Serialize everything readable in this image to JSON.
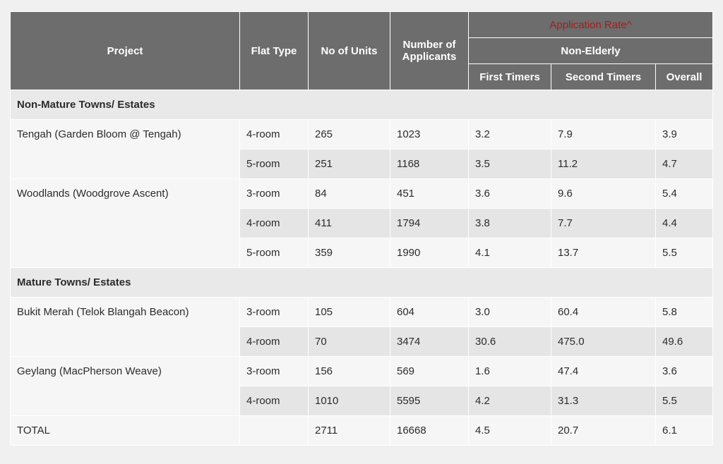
{
  "header": {
    "project": "Project",
    "flat_type": "Flat Type",
    "no_of_units": "No of Units",
    "number_of_applicants_line1": "Number of",
    "number_of_applicants_line2": "Applicants",
    "application_rate": "Application Rate^",
    "non_elderly": "Non-Elderly",
    "first_timers": "First Timers",
    "second_timers": "Second Timers",
    "overall": "Overall"
  },
  "sections": [
    {
      "title": "Non-Mature Towns/ Estates",
      "projects": [
        {
          "name": "Tengah (Garden Bloom @ Tengah)",
          "rows": [
            {
              "flat_type": "4-room",
              "units": "265",
              "applicants": "1023",
              "first": "3.2",
              "second": "7.9",
              "overall": "3.9"
            },
            {
              "flat_type": "5-room",
              "units": "251",
              "applicants": "1168",
              "first": "3.5",
              "second": "11.2",
              "overall": "4.7"
            }
          ]
        },
        {
          "name": "Woodlands (Woodgrove Ascent)",
          "rows": [
            {
              "flat_type": "3-room",
              "units": "84",
              "applicants": "451",
              "first": "3.6",
              "second": "9.6",
              "overall": "5.4"
            },
            {
              "flat_type": "4-room",
              "units": "411",
              "applicants": "1794",
              "first": "3.8",
              "second": "7.7",
              "overall": "4.4"
            },
            {
              "flat_type": "5-room",
              "units": "359",
              "applicants": "1990",
              "first": "4.1",
              "second": "13.7",
              "overall": "5.5"
            }
          ]
        }
      ]
    },
    {
      "title": "Mature Towns/ Estates",
      "projects": [
        {
          "name": "Bukit Merah (Telok Blangah Beacon)",
          "rows": [
            {
              "flat_type": "3-room",
              "units": "105",
              "applicants": "604",
              "first": "3.0",
              "second": "60.4",
              "overall": "5.8"
            },
            {
              "flat_type": "4-room",
              "units": "70",
              "applicants": "3474",
              "first": "30.6",
              "second": "475.0",
              "overall": "49.6"
            }
          ]
        },
        {
          "name": "Geylang (MacPherson Weave)",
          "rows": [
            {
              "flat_type": "3-room",
              "units": "156",
              "applicants": "569",
              "first": "1.6",
              "second": "47.4",
              "overall": "3.6"
            },
            {
              "flat_type": "4-room",
              "units": "1010",
              "applicants": "5595",
              "first": "4.2",
              "second": "31.3",
              "overall": "5.5"
            }
          ]
        }
      ]
    }
  ],
  "total": {
    "label": "TOTAL",
    "units": "2711",
    "applicants": "16668",
    "first": "4.5",
    "second": "20.7",
    "overall": "6.1"
  },
  "colors": {
    "header_bg": "#6d6d6d",
    "header_text": "#ffffff",
    "rate_title": "#a91b1b",
    "row_light": "#f6f6f6",
    "row_dark": "#e5e5e5",
    "page_bg": "#f0f0f0"
  }
}
